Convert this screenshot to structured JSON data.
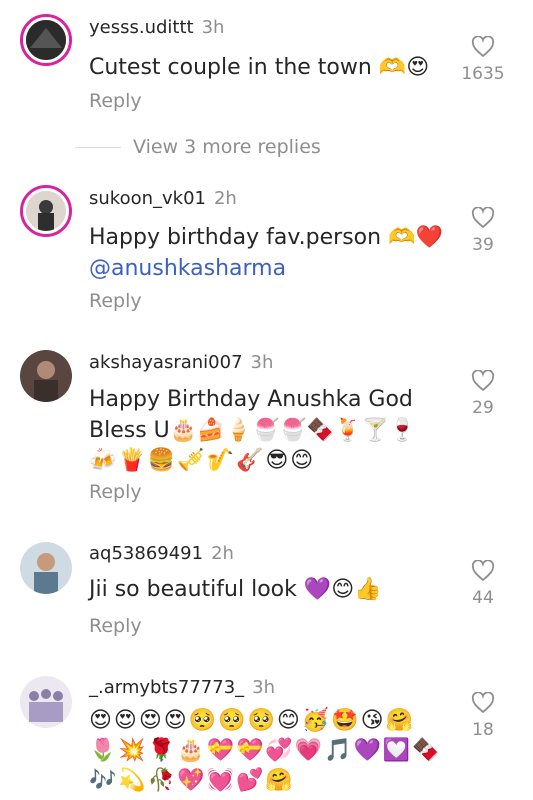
{
  "comments": [
    {
      "username": "yesss.udittt",
      "time": "3h",
      "text": "Cutest couple in the town 🫶😍",
      "reply": "Reply",
      "likes": "1635"
    },
    {
      "username": "sukoon_vk01",
      "time": "2h",
      "text": "Happy birthday fav.person 🫶❤️",
      "mention": "@anushkasharma",
      "reply": "Reply",
      "likes": "39"
    },
    {
      "username": "akshayasrani007",
      "time": "3h",
      "text": "Happy Birthday Anushka God Bless U🎂🍰🍦🍧🍧🍫🍹🍸🍷",
      "emojis": "🍻🍟🍔🎺🎷🎸😎😊",
      "reply": "Reply",
      "likes": "29"
    },
    {
      "username": "aq53869491",
      "time": "2h",
      "text": "Jii so beautiful look 💜😊👍",
      "reply": "Reply",
      "likes": "44"
    },
    {
      "username": "_.armybts77773_",
      "time": "3h",
      "emojis_1": "😍😍😍😍🥺🥺🥺😊🥳🤩😘🤗",
      "emojis_2": "🌷💥🌹🎂💝💝💞💗🎵💜💟🍫",
      "emojis_3": "🎶💫🥀💖💓💕🤗",
      "likes": "18"
    }
  ],
  "view_more": "View 3 more replies",
  "colors": {
    "ring": "#d6249f",
    "mention": "#3b5fc4",
    "muted": "#8e8e8e"
  }
}
